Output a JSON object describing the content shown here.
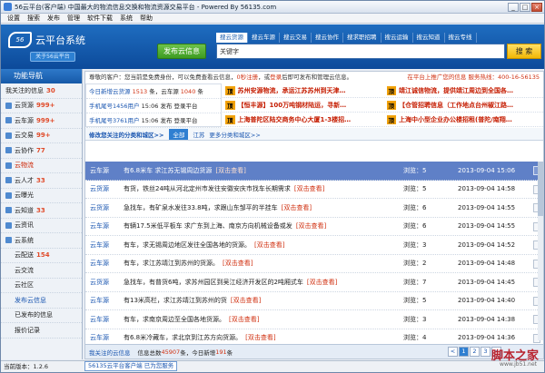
{
  "window": {
    "title": "56云平台(客户端) 中国最大的物流信息交换和物流资源交易平台 - Powered By 56135.com",
    "controls": [
      "_",
      "□",
      "×"
    ]
  },
  "menubar": [
    "设置",
    "搜索",
    "发布",
    "管理",
    "软件下载",
    "系统",
    "帮助"
  ],
  "header": {
    "logo_mark": "56",
    "logo_name": "云平台系统",
    "about_label": "关于56云平台",
    "publish_label": "发布云信息",
    "search_tabs": [
      "搜云货源",
      "搜云车源",
      "搜云交易",
      "搜云协作",
      "搜求职招聘",
      "搜云运输",
      "搜云知道",
      "搜云专线"
    ],
    "search_label": "关键字",
    "search_value": "",
    "search_button": "搜 索"
  },
  "sidebar": {
    "title": "功能导航",
    "items": [
      {
        "label": "我关注的信息",
        "count": "30",
        "type": "top"
      },
      {
        "label": "云货源",
        "count": "999+",
        "type": "icon"
      },
      {
        "label": "云车源",
        "count": "999+",
        "type": "icon"
      },
      {
        "label": "云交易",
        "count": "99+",
        "type": "icon"
      },
      {
        "label": "云协作",
        "count": "77",
        "type": "icon"
      },
      {
        "label": "云物流",
        "count": "",
        "type": "icon-red"
      },
      {
        "label": "云人才",
        "count": "33",
        "type": "icon"
      },
      {
        "label": "云曝光",
        "count": "",
        "type": "icon"
      },
      {
        "label": "云知道",
        "count": "33",
        "type": "icon"
      },
      {
        "label": "云资讯",
        "count": "",
        "type": "icon"
      },
      {
        "label": "云系统",
        "count": "",
        "type": "icon"
      },
      {
        "label": "云配送",
        "count": "154",
        "type": "sub"
      },
      {
        "label": "云交流",
        "count": "",
        "type": "sub"
      },
      {
        "label": "云社区",
        "count": "",
        "type": "sub"
      },
      {
        "label": "发布云信息",
        "count": "",
        "type": "sub-blue"
      },
      {
        "label": "已发布的信息",
        "count": "",
        "type": "sub"
      },
      {
        "label": "报价记录",
        "count": "",
        "type": "sub"
      }
    ]
  },
  "welcome": {
    "text": "尊敬的客户：您当前是免费身份，可以免费查看云信息，",
    "link1": "0秒注册",
    "mid": "，或",
    "link2": "登录",
    "tail": "后即可发布和管理云信息。",
    "right": "在平台上推广您的信息 服务热线：400-16-56135"
  },
  "stats": [
    {
      "a": "今日新增云货源",
      "b": "1513",
      "c": "条，云车源",
      "d": "1040",
      "e": "条"
    },
    {
      "a": "手机尾号1456用户",
      "b": "15:06",
      "c": "发布",
      "d": "登录平台",
      "e": ""
    },
    {
      "a": "手机尾号3761用户",
      "b": "15:06",
      "c": "发布",
      "d": "登录平台",
      "e": ""
    }
  ],
  "ads": [
    [
      "苏州安源物流，承运江苏苏州到天津…",
      "靖江诚信物流，提供靖江周边到全国各…"
    ],
    [
      "【恒丰源】100万吨钢材陆运，寻新…",
      "【仓管招聘信息（工作地点台州椒江路…"
    ],
    [
      "上海普陀区陆交商务中心大厦1-3楼招…",
      "上海中小型企业办公楼招租(普陀/南翔…"
    ]
  ],
  "region": {
    "title": "修改您关注的分类和城区>>",
    "chip": "全部",
    "city": "江苏",
    "more": "更多分类和城区>>"
  },
  "rows": [
    {
      "type": "云车源",
      "content": "有6.8米车 求江苏无锡周边货源",
      "view": "[双击查看]",
      "count": "浏览：5",
      "date": "2013-09-04 15:06",
      "selected": true
    },
    {
      "type": "云货源",
      "content": "有货，铁丝24吨从河北定州市发往安徽安庆市找车长期需求",
      "view": "[双击查看]",
      "count": "浏览：5",
      "date": "2013-09-04 14:58",
      "selected": false
    },
    {
      "type": "云货源",
      "content": "急找车，有矿泉水发往33.8吨，求跟山东邹平的半挂车",
      "view": "[双击查看]",
      "count": "浏览：6",
      "date": "2013-09-04 14:55",
      "selected": false
    },
    {
      "type": "云车源",
      "content": "有辆17.5米低平板车 求广东到上海、南京方向机械设备或发",
      "view": "[双击查看]",
      "count": "浏览：6",
      "date": "2013-09-04 14:55",
      "selected": false
    },
    {
      "type": "云车源",
      "content": "有车，求无锡周边地区发往全国各地的货源。",
      "view": "[双击查看]",
      "count": "浏览：3",
      "date": "2013-09-04 14:52",
      "selected": false
    },
    {
      "type": "云车源",
      "content": "有车，求江苏靖江到苏州的货源。",
      "view": "[双击查看]",
      "count": "浏览：2",
      "date": "2013-09-04 14:48",
      "selected": false
    },
    {
      "type": "云货源",
      "content": "急找车，有普货6吨，求苏州园区到吴江经济开发区的2吨厢式车",
      "view": "[双击查看]",
      "count": "浏览：7",
      "date": "2013-09-04 14:45",
      "selected": false
    },
    {
      "type": "云车源",
      "content": "有13米高栏，求江苏靖江到苏州的货",
      "view": "[双击查看]",
      "count": "浏览：5",
      "date": "2013-09-04 14:40",
      "selected": false
    },
    {
      "type": "云车源",
      "content": "有车，求南京周边至全国各地货源。",
      "view": "[双击查看]",
      "count": "浏览：3",
      "date": "2013-09-04 14:38",
      "selected": false
    },
    {
      "type": "云车源",
      "content": "有6.8米冷藏车，求北京到江苏方向货源。",
      "view": "[双击查看]",
      "count": "浏览：4",
      "date": "2013-09-04 14:36",
      "selected": false
    }
  ],
  "footer": {
    "text": "我关注的云信息",
    "total_label": "信息总数",
    "total": "45907",
    "unit": "条，今日新增",
    "today": "191",
    "unit2": "条",
    "pages": [
      "<",
      "1",
      "2",
      "3",
      ">"
    ]
  },
  "statusbar": {
    "version": "当前版本：1.2.6",
    "message": "56135云平台客户端 已为您服务"
  },
  "watermark": {
    "text": "脚本之家",
    "sub": "www.jb51.net"
  }
}
